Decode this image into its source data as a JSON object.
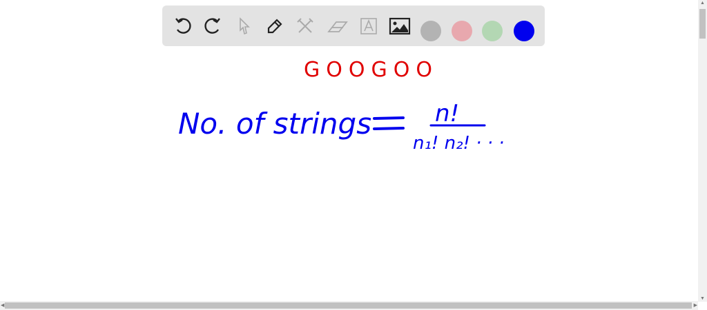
{
  "toolbar": {
    "tools": [
      "undo-icon",
      "redo-icon",
      "select-icon",
      "pen-icon",
      "tools-icon",
      "eraser-icon",
      "text-icon",
      "image-icon"
    ],
    "colors": [
      "#b3b3b3",
      "#e8a8ae",
      "#b3d7b3",
      "#0000ee"
    ]
  },
  "canvas": {
    "title_word": "GOOGOO",
    "formula_lhs": "No. of strings",
    "equals": "=",
    "numerator": "n!",
    "denominator": "n₁! n₂! · · ·",
    "ink_red": "#e00000",
    "ink_blue": "#0000ee"
  }
}
